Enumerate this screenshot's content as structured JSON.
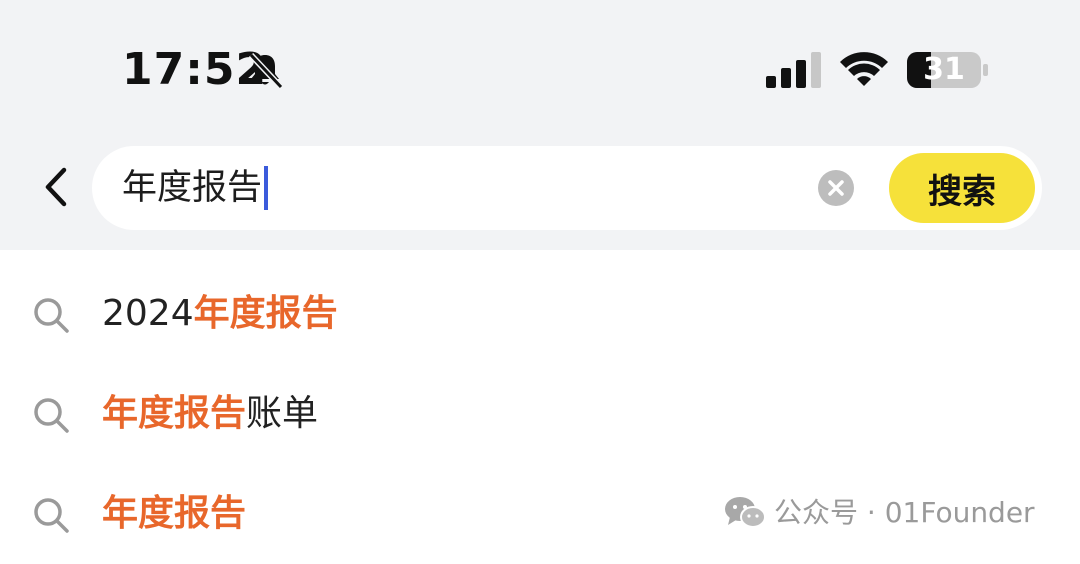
{
  "status_bar": {
    "time": "17:52",
    "battery_level": "31",
    "icons": [
      "bell-slash-icon",
      "cellular-signal-icon",
      "wifi-icon",
      "battery-icon"
    ]
  },
  "search": {
    "query": "年度报告",
    "button_label": "搜索",
    "button_color": "#f6e13a"
  },
  "suggestions": [
    {
      "prefix": "2024",
      "highlight": "年度报告",
      "suffix": ""
    },
    {
      "prefix": "",
      "highlight": "年度报告",
      "suffix": "账单"
    },
    {
      "prefix": "",
      "highlight": "年度报告",
      "suffix": ""
    }
  ],
  "highlight_color": "#e8672b",
  "watermark": {
    "text": "公众号 · 01Founder",
    "icon": "wechat-icon"
  }
}
